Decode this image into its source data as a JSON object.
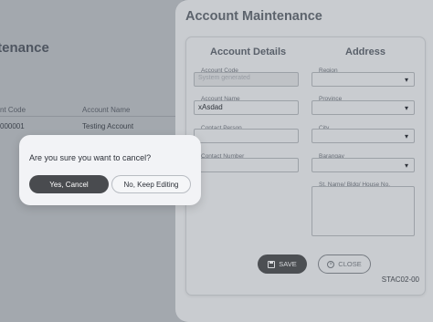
{
  "background_page": {
    "title_fragment": "ntenance",
    "columns": [
      "nt Code",
      "Account Name"
    ],
    "row": [
      "000001",
      "Testing Account"
    ]
  },
  "drawer": {
    "title": "Account Maintenance",
    "sections": {
      "left": "Account Details",
      "right": "Address"
    },
    "fields": {
      "account_code": {
        "label": "Account Code",
        "placeholder": "System generated"
      },
      "account_name": {
        "label": "Account Name",
        "value": "xAsdad"
      },
      "contact_person": {
        "label": "Contact Person",
        "value": ""
      },
      "contact_number": {
        "label": "Contact Number",
        "value": ""
      },
      "region": {
        "label": "Region",
        "value": ""
      },
      "province": {
        "label": "Province",
        "value": ""
      },
      "city": {
        "label": "City",
        "value": ""
      },
      "barangay": {
        "label": "Barangay",
        "value": ""
      },
      "street": {
        "label": "St. Name/ Bldg/ House No.",
        "value": ""
      }
    },
    "buttons": {
      "save": "SAVE",
      "close": "CLOSE"
    },
    "form_code": "STAC02-00"
  },
  "modal": {
    "message": "Are you sure you want to cancel?",
    "confirm": "Yes, Cancel",
    "dismiss": "No, Keep Editing"
  },
  "colors": {
    "confirm_button": "#494b4f",
    "save_button": "#4c4f53",
    "overlay": "#9ba0a6"
  }
}
